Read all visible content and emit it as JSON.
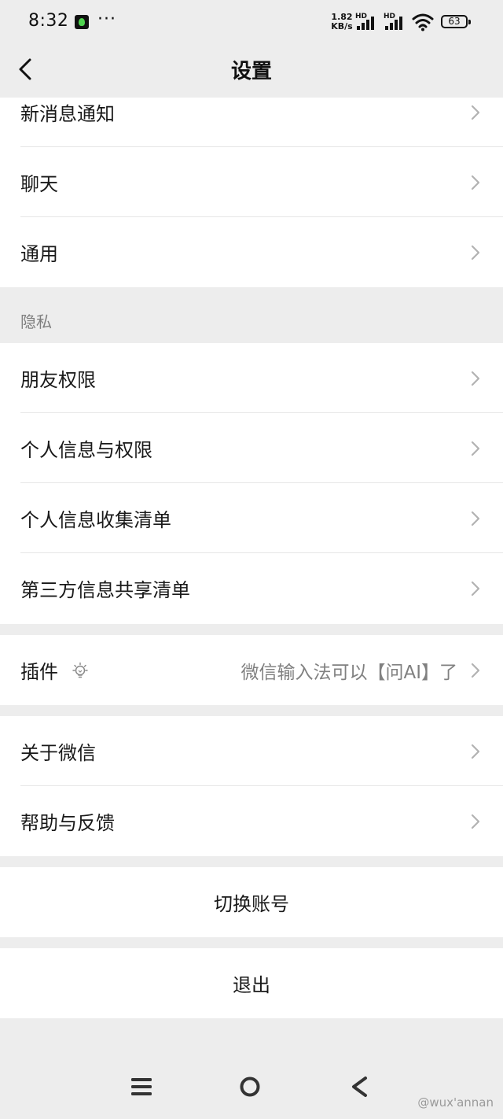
{
  "status_bar": {
    "time": "8:32",
    "dots": "···",
    "net_speed_value": "1.82",
    "net_speed_unit": "KB/s",
    "hd1": "HD",
    "hd2": "HD",
    "battery": "63"
  },
  "header": {
    "title": "设置",
    "back_icon": "chevron-left-icon"
  },
  "group_top": [
    {
      "label": "新消息通知"
    },
    {
      "label": "聊天"
    },
    {
      "label": "通用"
    }
  ],
  "privacy": {
    "section_label": "隐私",
    "items": [
      {
        "label": "朋友权限"
      },
      {
        "label": "个人信息与权限"
      },
      {
        "label": "个人信息收集清单"
      },
      {
        "label": "第三方信息共享清单"
      }
    ]
  },
  "plugin": {
    "label": "插件",
    "hint": "微信输入法可以【问AI】了",
    "icon": "lightbulb-icon"
  },
  "group_about": [
    {
      "label": "关于微信"
    },
    {
      "label": "帮助与反馈"
    }
  ],
  "actions": {
    "switch_account": "切换账号",
    "logout": "退出"
  },
  "watermark": "@wux'annan",
  "colors": {
    "background": "#ededed",
    "card": "#ffffff",
    "text": "#191919",
    "secondary_text": "#7f7f7f",
    "chevron": "#b2b2b2"
  }
}
